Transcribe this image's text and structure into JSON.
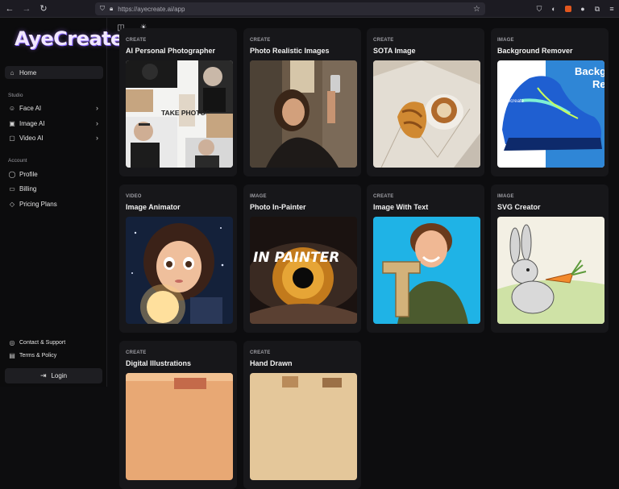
{
  "browser": {
    "url": "https://ayecreate.ai/app"
  },
  "app": {
    "logo": "AyeCreate"
  },
  "sidebar": {
    "home": "Home",
    "studio_section": "Studio",
    "studio_items": [
      {
        "label": "Face AI"
      },
      {
        "label": "Image AI"
      },
      {
        "label": "Video AI"
      }
    ],
    "account_section": "Account",
    "account_items": [
      {
        "label": "Profile"
      },
      {
        "label": "Billing"
      },
      {
        "label": "Pricing Plans"
      }
    ],
    "footer_items": [
      {
        "label": "Contact & Support"
      },
      {
        "label": "Terms & Policy"
      }
    ],
    "login": "Login"
  },
  "cards": [
    {
      "category": "CREATE",
      "title": "AI Personal Photographer",
      "thumb_text": "TAKE PHOTOS"
    },
    {
      "category": "CREATE",
      "title": "Photo Realistic Images"
    },
    {
      "category": "CREATE",
      "title": "SOTA Image"
    },
    {
      "category": "IMAGE",
      "title": "Background Remover",
      "thumb_text_1": "Backg",
      "thumb_text_2": "Re",
      "thumb_brand": "Ayecreate"
    },
    {
      "category": "VIDEO",
      "title": "Image Animator"
    },
    {
      "category": "IMAGE",
      "title": "Photo In-Painter",
      "thumb_text": "IN PAINTER"
    },
    {
      "category": "CREATE",
      "title": "Image With Text"
    },
    {
      "category": "IMAGE",
      "title": "SVG Creator"
    },
    {
      "category": "CREATE",
      "title": "Digital Illustrations"
    },
    {
      "category": "CREATE",
      "title": "Hand Drawn"
    }
  ],
  "colors": {
    "background": "#0d0d0f",
    "card": "#17171a",
    "sidebar": "#0c0c0d",
    "logo_glow": "#7c5cff"
  }
}
